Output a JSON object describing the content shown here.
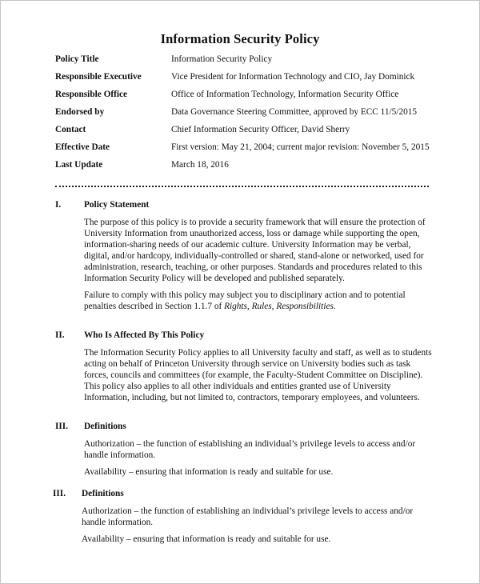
{
  "document": {
    "title": "Information Security Policy",
    "meta": [
      {
        "label": "Policy Title",
        "value": "Information Security Policy"
      },
      {
        "label": "Responsible Executive",
        "value": "Vice President for Information Technology and CIO, Jay Dominick"
      },
      {
        "label": "Responsible Office",
        "value": "Office of Information Technology, Information Security Office"
      },
      {
        "label": "Endorsed by",
        "value": "Data Governance Steering Committee, approved by ECC 11/5/2015"
      },
      {
        "label": "Contact",
        "value": "Chief Information Security Officer, David Sherry"
      },
      {
        "label": "Effective Date",
        "value": "First version: May 21, 2004; current major revision: November 5, 2015"
      },
      {
        "label": "Last Update",
        "value": "March 18, 2016"
      }
    ],
    "sections": [
      {
        "number": "I.",
        "title": "Policy Statement",
        "paragraphs": [
          "The purpose of this policy is to provide a security framework that will ensure the protection of University Information from unauthorized access, loss or damage while supporting the open, information-sharing needs of our academic culture. University Information may be verbal, digital, and/or hardcopy, individually-controlled or shared, stand-alone or networked, used for administration, research, teaching, or other purposes. Standards and procedures related to this Information Security Policy will be developed and published separately."
        ],
        "failure_para": {
          "before": "Failure to comply with this policy may subject you to disciplinary action and to potential penalties described in Section 1.1.7 of ",
          "italic": "Rights, Rules, Responsibilities",
          "after": "."
        }
      },
      {
        "number": "II.",
        "title": "Who Is Affected By This Policy",
        "paragraphs": [
          "The Information Security Policy applies to all University faculty and staff, as well as to students acting on behalf of Princeton University through service on University bodies such as task forces, councils and committees (for example, the Faculty-Student Committee on Discipline). This policy also applies to all other individuals and entities granted use of University Information, including, but not limited to, contractors, temporary employees, and volunteers."
        ]
      },
      {
        "number": "III.",
        "title": "Definitions",
        "paragraphs": [
          "Authorization – the function of establishing an individual’s privilege levels to access and/or handle information.",
          "Availability – ensuring that information is ready and suitable for use."
        ]
      },
      {
        "number": "III.",
        "title": "Definitions",
        "paragraphs": [
          "Authorization – the function of establishing an individual’s privilege levels to access and/or handle information.",
          "Availability – ensuring that information is ready and suitable for use."
        ]
      }
    ]
  }
}
